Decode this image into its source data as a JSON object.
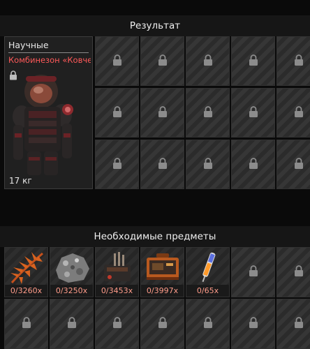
{
  "result": {
    "header": "Результат",
    "item": {
      "category": "Научные",
      "name": "Комбинезон «Ковче..",
      "weight": "17 кг",
      "icon": "armor-suit-icon",
      "locked_icon": "lock-icon"
    }
  },
  "required": {
    "header": "Необходимые предметы",
    "items": [
      {
        "icon": "orange-fern-icon",
        "count": "0/3260x"
      },
      {
        "icon": "gray-ore-icon",
        "count": "0/3250x"
      },
      {
        "icon": "device-icon",
        "count": "0/3453x"
      },
      {
        "icon": "orange-case-icon",
        "count": "0/3997x"
      },
      {
        "icon": "syringe-icon",
        "count": "0/65x"
      }
    ]
  },
  "colors": {
    "item_name": "#ff5959",
    "count_text": "#ff9c8a",
    "slot_bg": "#2b2b2b",
    "header_bg": "#161616"
  }
}
